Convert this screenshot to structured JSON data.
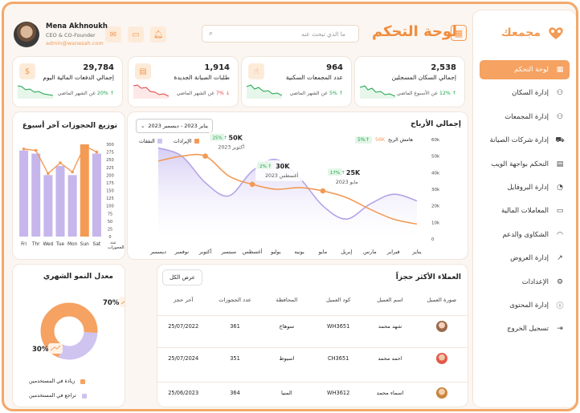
{
  "brand": {
    "name": "مجمعك"
  },
  "header": {
    "title": "لوحة التحكم",
    "search_placeholder": "ما الذي تبحث عنه",
    "user": {
      "name": "Mena Akhnoukh",
      "role": "CEO & CO-Founder",
      "email": "admin@wanesah.com"
    }
  },
  "sidebar": {
    "items": [
      {
        "label": "لوحة التحكم",
        "icon": "grid-icon"
      },
      {
        "label": "إدارة السكان",
        "icon": "users-icon"
      },
      {
        "label": "إدارة المجمعات",
        "icon": "buildings-icon"
      },
      {
        "label": "إدارة شركات الصيانة",
        "icon": "truck-icon"
      },
      {
        "label": "التحكم بواجهة الويب",
        "icon": "clipboard-icon"
      },
      {
        "label": "إدارة البروفايل",
        "icon": "user-icon"
      },
      {
        "label": "المعاملات المالية",
        "icon": "money-icon"
      },
      {
        "label": "الشكاوى والدعم",
        "icon": "headset-icon"
      },
      {
        "label": "إدارة العروض",
        "icon": "trend-icon"
      },
      {
        "label": "الإعدادات",
        "icon": "gear-icon"
      },
      {
        "label": "إدارة المحتوى",
        "icon": "info-icon"
      },
      {
        "label": "تسجيل الخروج",
        "icon": "logout-icon"
      }
    ]
  },
  "stats": [
    {
      "value": "2,538",
      "label": "إجمالي السكان المسجلين",
      "pct": "12%",
      "trend": "up",
      "period": "عن الأسبوع الماضي",
      "color": "#1aa34a"
    },
    {
      "value": "964",
      "label": "عدد المجمعات السكنية",
      "pct": "5%",
      "trend": "up",
      "period": "عن الشهر الماضي",
      "color": "#1aa34a"
    },
    {
      "value": "1,914",
      "label": "طلبات الصيانة الجديدة",
      "pct": "7%",
      "trend": "down",
      "period": "عن الشهر الماضي",
      "color": "#e43d3d"
    },
    {
      "value": "29,784",
      "label": "إجمالي الدفعات المالية اليوم",
      "pct": "20%",
      "trend": "up",
      "period": "عن الشهر الماضي",
      "color": "#1aa34a"
    }
  ],
  "revenue": {
    "title": "إجمالي الأرباح",
    "date_range": "يناير 2023 - ديسمبر 2023",
    "margin_label": "هامش الربح",
    "margin_value": "56K",
    "margin_pct": "5%",
    "legend": {
      "revenue": "الإيرادات",
      "expenses": "النفقات"
    }
  },
  "bookings": {
    "title": "توزيع الحجوزات آخر أسبوع",
    "axis_label": "عدد الحجوزات"
  },
  "growth": {
    "title": "معدل النمو الشهري",
    "increase_label": "زيادة في المستخدمين",
    "decrease_label": "تراجع في المستخدمين"
  },
  "clients": {
    "title": "العملاء الأكثر حجزاً",
    "view_all": "عرض الكل",
    "columns": [
      "صورة العميل",
      "اسم العميل",
      "كود العميل",
      "المحافظة",
      "عدد الحجوزات",
      "آخر حجز"
    ],
    "rows": [
      {
        "name": "شهد محمد",
        "code": "WH3651",
        "gov": "سوهاج",
        "count": "361",
        "last": "25/07/2022"
      },
      {
        "name": "احمد محمد",
        "code": "CH3651",
        "gov": "اسيوط",
        "count": "351",
        "last": "25/07/2024"
      },
      {
        "name": "اسماء محمد",
        "code": "WH3612",
        "gov": "المنيا",
        "count": "364",
        "last": "25/06/2023"
      }
    ]
  },
  "chart_data": [
    {
      "type": "area",
      "title": "إجمالي الأرباح",
      "categories": [
        "يناير",
        "فبراير",
        "مارس",
        "إبريل",
        "مايو",
        "يونيه",
        "يوليو",
        "أغسطس",
        "سبتمبر",
        "أكتوبر",
        "نوفمبر",
        "ديسمبر"
      ],
      "ylim": [
        0,
        60
      ],
      "yticks": [
        "0",
        "10k",
        "20k",
        "30k",
        "40k",
        "50k",
        "60k"
      ],
      "series": [
        {
          "name": "الإيرادات",
          "color": "#f39a55",
          "values": [
            9,
            12,
            18,
            25,
            29,
            31,
            30,
            33,
            38,
            50,
            50,
            47
          ]
        },
        {
          "name": "النفقات",
          "color": "#b3a3e6",
          "values": [
            23,
            27,
            21,
            12,
            20,
            37,
            48,
            41,
            26,
            34,
            50,
            55
          ]
        }
      ],
      "annotations": [
        {
          "label": "50K",
          "pct": "25%",
          "month": "أكتوبر 2023"
        },
        {
          "label": "30K",
          "pct": "2%",
          "month": "أغسطس 2023"
        },
        {
          "label": "25K",
          "pct": "17%",
          "month": "مايو 2023"
        }
      ]
    },
    {
      "type": "bar",
      "title": "توزيع الحجوزات آخر أسبوع",
      "categories": [
        "Fri",
        "Thr",
        "Wed",
        "Tue",
        "Mon",
        "Sun",
        "Sat"
      ],
      "values": [
        280,
        270,
        200,
        230,
        200,
        300,
        270
      ],
      "highlight_index": 5,
      "ylim": [
        0,
        300
      ],
      "yticks": [
        "0",
        "25",
        "50",
        "75",
        "100",
        "125",
        "150",
        "175",
        "200",
        "225",
        "250",
        "275",
        "300"
      ],
      "line": [
        285,
        280,
        205,
        240,
        210,
        295,
        275
      ],
      "colors": {
        "bar": "#c6b6ec",
        "highlight": "#f39a55",
        "line": "#f39a55"
      }
    },
    {
      "type": "pie",
      "title": "معدل النمو الشهري",
      "slices": [
        {
          "label": "زيادة في المستخدمين",
          "value": 70,
          "display": "70%",
          "color": "#f5a262"
        },
        {
          "label": "تراجع في المستخدمين",
          "value": 30,
          "display": "30%",
          "color": "#cfc3ef"
        }
      ]
    }
  ]
}
